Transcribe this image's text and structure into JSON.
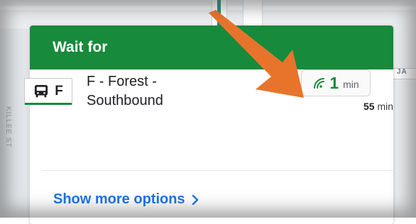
{
  "map": {
    "street_left": "KILLEE ST",
    "street_right": "JA"
  },
  "card": {
    "header_title": "Wait for",
    "route": {
      "code": "F",
      "name_line1": "F - Forest -",
      "name_line2": "Southbound",
      "icon": "bus-icon"
    },
    "eta": {
      "value": "1",
      "unit": "min",
      "icon": "live-signal-icon"
    },
    "next_eta": {
      "value": "55",
      "unit": "min"
    },
    "more_link": "Show more options"
  },
  "colors": {
    "header_green": "#188a3b",
    "annotation_arrow": "#e8742c",
    "link_blue": "#1a73e8"
  }
}
